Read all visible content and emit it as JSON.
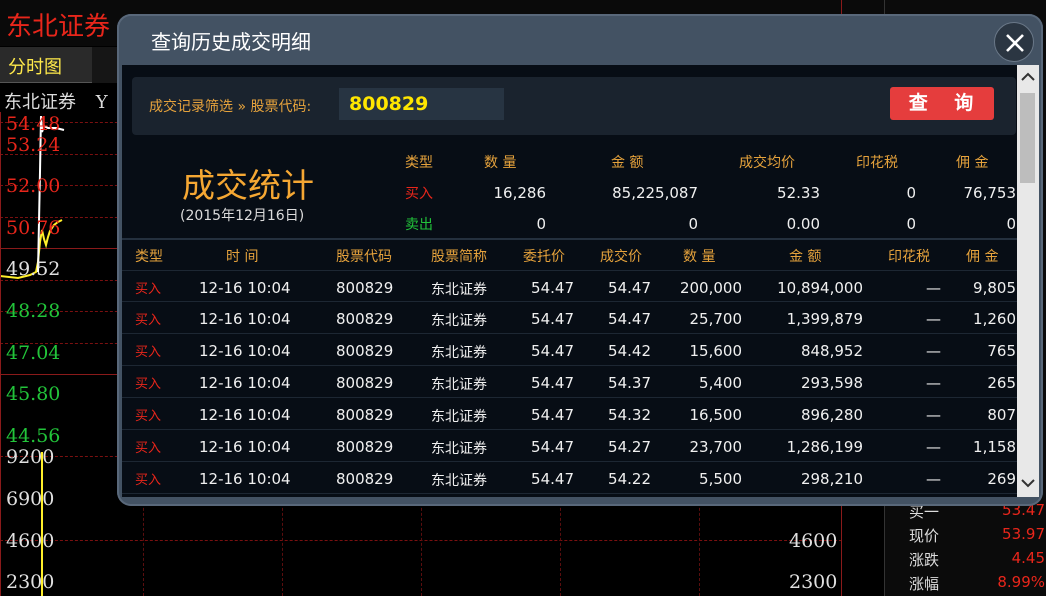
{
  "background": {
    "app_title": "东北证券",
    "tab_label": "分时图",
    "stock_name": "东北证券",
    "stock_code_fragment": "Y",
    "price_levels": [
      {
        "text": "54.48",
        "tone": "red"
      },
      {
        "text": "53.24",
        "tone": "red"
      },
      {
        "text": "52.00",
        "tone": "red"
      },
      {
        "text": "50.76",
        "tone": "red"
      },
      {
        "text": "49.52",
        "tone": "white"
      },
      {
        "text": "48.28",
        "tone": "green"
      },
      {
        "text": "47.04",
        "tone": "green"
      },
      {
        "text": "45.80",
        "tone": "green"
      },
      {
        "text": "44.56",
        "tone": "green"
      }
    ],
    "volume_levels": [
      "9200",
      "6900",
      "4600",
      "2300"
    ],
    "volume_right_labels": [
      "4600",
      "2300"
    ],
    "quote_panel": [
      {
        "label": "买一",
        "value": "53.47"
      },
      {
        "label": "现价",
        "value": "53.97"
      },
      {
        "label": "涨跌",
        "value": "4.45"
      },
      {
        "label": "涨幅",
        "value": "8.99%"
      }
    ]
  },
  "dialog": {
    "title": "查询历史成交明细",
    "filter_label": "成交记录筛选 » 股票代码:",
    "stock_code": "800829",
    "query_button": "查 询",
    "stats": {
      "title": "成交统计",
      "date": "(2015年12月16日)",
      "headers": [
        "类型",
        "数 量",
        "金 额",
        "成交均价",
        "印花税",
        "佣 金"
      ],
      "buy": {
        "type": "买入",
        "quantity": "16,286",
        "amount": "85,225,087",
        "avg_price": "52.33",
        "stamp_tax": "0",
        "commission": "76,753"
      },
      "sell": {
        "type": "卖出",
        "quantity": "0",
        "amount": "0",
        "avg_price": "0.00",
        "stamp_tax": "0",
        "commission": "0"
      }
    },
    "table": {
      "columns": [
        "类型",
        "时 间",
        "股票代码",
        "股票简称",
        "委托价",
        "成交价",
        "数 量",
        "金 额",
        "印花税",
        "佣 金"
      ],
      "rows": [
        {
          "type": "买入",
          "time": "12-16 10:04",
          "code": "800829",
          "name": "东北证券",
          "order_price": "54.47",
          "deal_price": "54.47",
          "qty": "200,000",
          "amount": "10,894,000",
          "tax": "—",
          "fee": "9,805"
        },
        {
          "type": "买入",
          "time": "12-16 10:04",
          "code": "800829",
          "name": "东北证券",
          "order_price": "54.47",
          "deal_price": "54.47",
          "qty": "25,700",
          "amount": "1,399,879",
          "tax": "—",
          "fee": "1,260"
        },
        {
          "type": "买入",
          "time": "12-16 10:04",
          "code": "800829",
          "name": "东北证券",
          "order_price": "54.47",
          "deal_price": "54.42",
          "qty": "15,600",
          "amount": "848,952",
          "tax": "—",
          "fee": "765"
        },
        {
          "type": "买入",
          "time": "12-16 10:04",
          "code": "800829",
          "name": "东北证券",
          "order_price": "54.47",
          "deal_price": "54.37",
          "qty": "5,400",
          "amount": "293,598",
          "tax": "—",
          "fee": "265"
        },
        {
          "type": "买入",
          "time": "12-16 10:04",
          "code": "800829",
          "name": "东北证券",
          "order_price": "54.47",
          "deal_price": "54.32",
          "qty": "16,500",
          "amount": "896,280",
          "tax": "—",
          "fee": "807"
        },
        {
          "type": "买入",
          "time": "12-16 10:04",
          "code": "800829",
          "name": "东北证券",
          "order_price": "54.47",
          "deal_price": "54.27",
          "qty": "23,700",
          "amount": "1,286,199",
          "tax": "—",
          "fee": "1,158"
        },
        {
          "type": "买入",
          "time": "12-16 10:04",
          "code": "800829",
          "name": "东北证券",
          "order_price": "54.47",
          "deal_price": "54.22",
          "qty": "5,500",
          "amount": "298,210",
          "tax": "—",
          "fee": "269"
        }
      ]
    }
  },
  "colors": {
    "accent_orange": "#e5a23c",
    "buy_red": "#e8261b",
    "sell_green": "#22c43a",
    "code_yellow": "#ffe600",
    "query_red": "#e53d3d",
    "dialog_frame": "#435263"
  }
}
